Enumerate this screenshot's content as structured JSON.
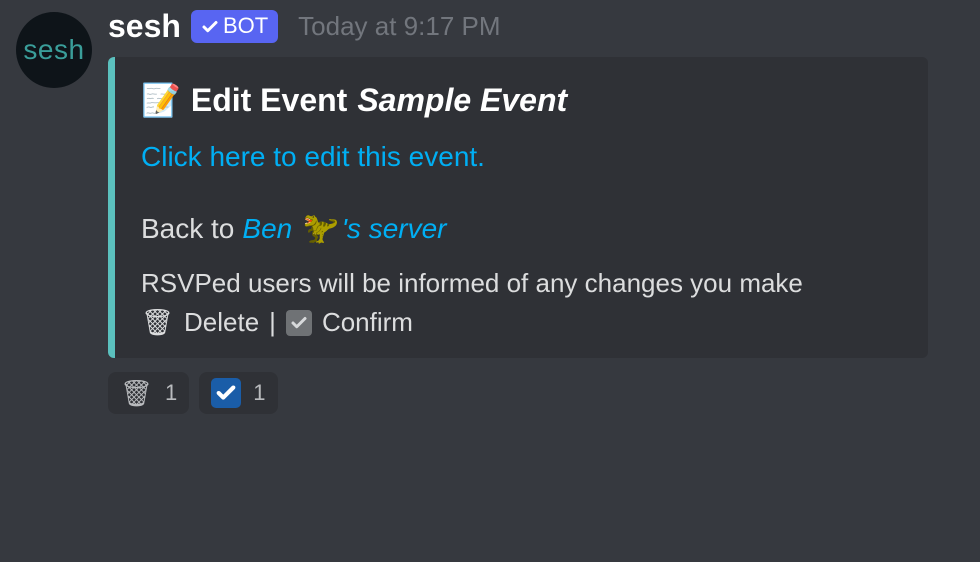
{
  "author": {
    "name": "sesh",
    "avatar_text": "sesh",
    "bot_label": "BOT"
  },
  "timestamp": "Today at 9:17 PM",
  "embed": {
    "accent_color": "#5bc0be",
    "title_icon": "📝",
    "title_prefix": "Edit Event",
    "title_event_name": "Sample Event",
    "edit_link_text": "Click here to edit this event.",
    "back_prefix": "Back to",
    "back_server_name_a": "Ben",
    "back_server_name_b": "'s server",
    "info_text": "RSVPed users will be informed of any changes you make",
    "delete_icon": "🗑",
    "delete_label": "Delete",
    "separator": "|",
    "confirm_label": "Confirm"
  },
  "reactions": [
    {
      "emoji_name": "trash",
      "emoji": "🗑",
      "count": "1"
    },
    {
      "emoji_name": "check",
      "count": "1"
    }
  ]
}
